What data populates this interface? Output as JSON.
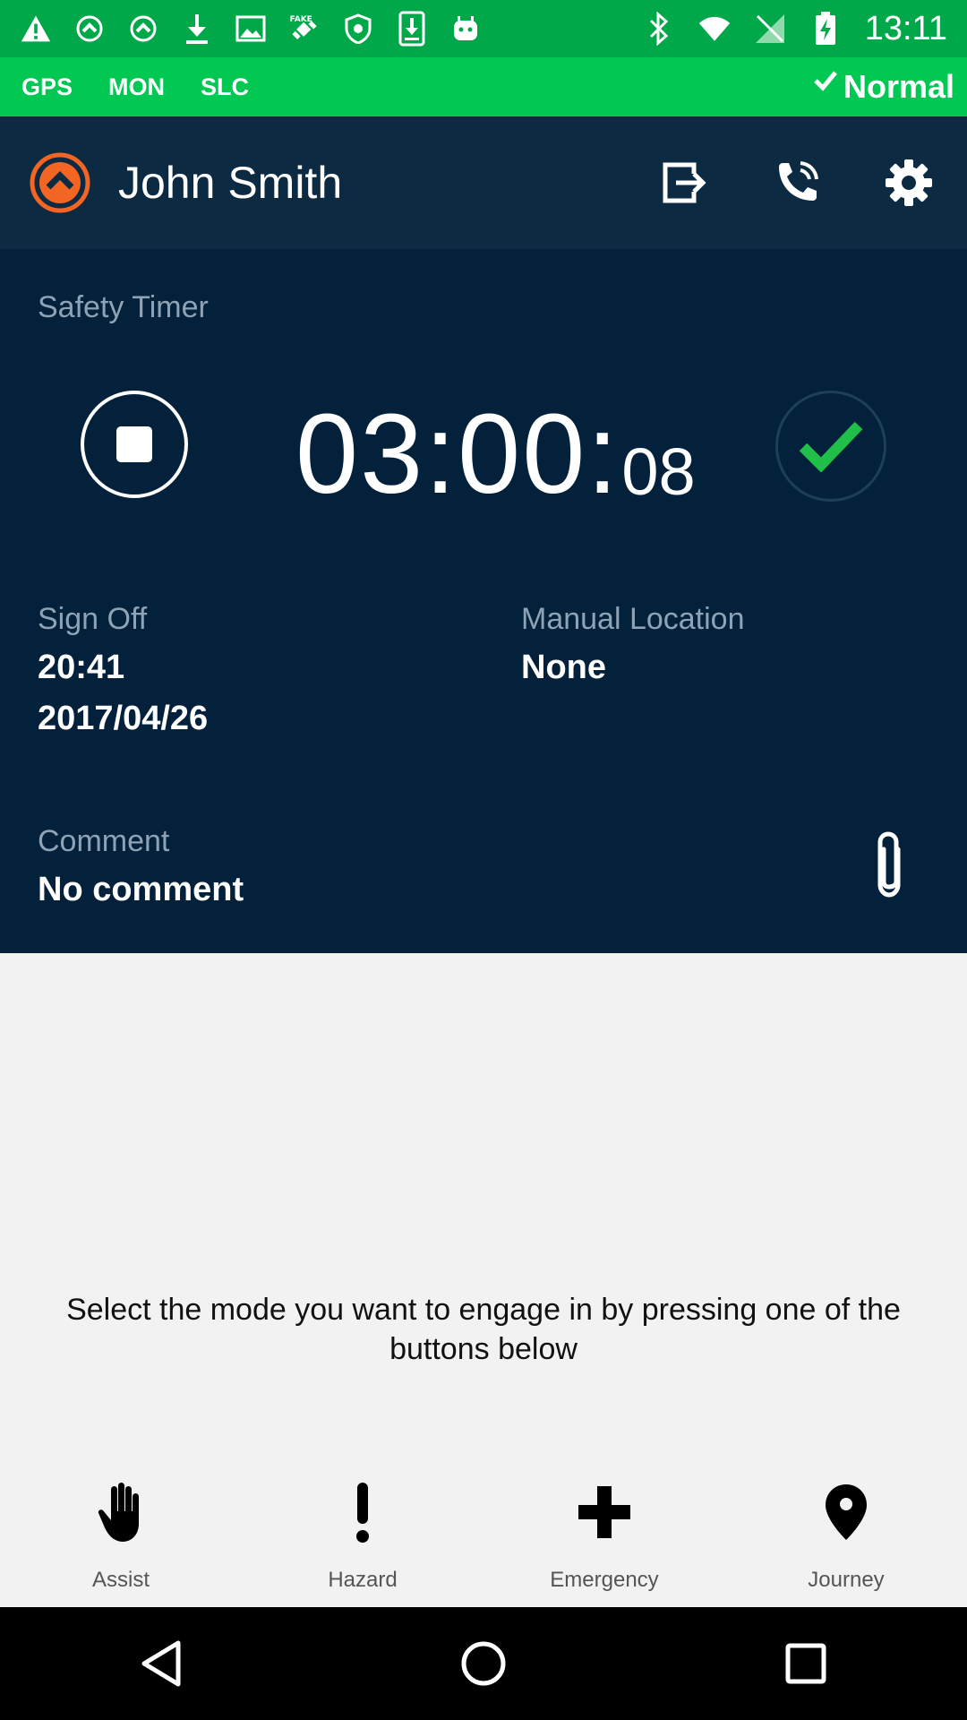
{
  "status_bar": {
    "time": "13:11",
    "left_icons": [
      "warning-icon",
      "app-up-icon",
      "app-up-icon",
      "download-icon",
      "image-icon",
      "fake-gps-icon",
      "shield-icon",
      "sd-download-icon",
      "android-icon"
    ],
    "right_icons": [
      "bluetooth-icon",
      "wifi-icon",
      "no-signal-icon",
      "battery-charging-icon"
    ]
  },
  "mode_bar": {
    "tags": [
      "GPS",
      "MON",
      "SLC"
    ],
    "status": "Normal",
    "status_icon": "check-icon"
  },
  "header": {
    "user_name": "John Smith",
    "actions": [
      "logout-icon",
      "phone-icon",
      "gear-icon"
    ]
  },
  "safety_timer": {
    "title": "Safety Timer",
    "time_main": "03:00:",
    "time_seconds": "08"
  },
  "sign_off": {
    "label": "Sign Off",
    "time": "20:41",
    "date": "2017/04/26"
  },
  "manual_location": {
    "label": "Manual Location",
    "value": "None"
  },
  "comment": {
    "label": "Comment",
    "value": "No comment"
  },
  "instruction": "Select the mode you want to engage in by pressing one of the buttons below",
  "modes": [
    {
      "label": "Assist",
      "icon": "hand-icon"
    },
    {
      "label": "Hazard",
      "icon": "exclamation-icon"
    },
    {
      "label": "Emergency",
      "icon": "plus-icon"
    },
    {
      "label": "Journey",
      "icon": "location-pin-icon"
    }
  ],
  "colors": {
    "status_bar": "#00a84a",
    "mode_bar": "#00c853",
    "header": "#0d2a43",
    "panel": "#03213a",
    "accent_orange": "#f26522",
    "check_green": "#1fbf4a"
  }
}
